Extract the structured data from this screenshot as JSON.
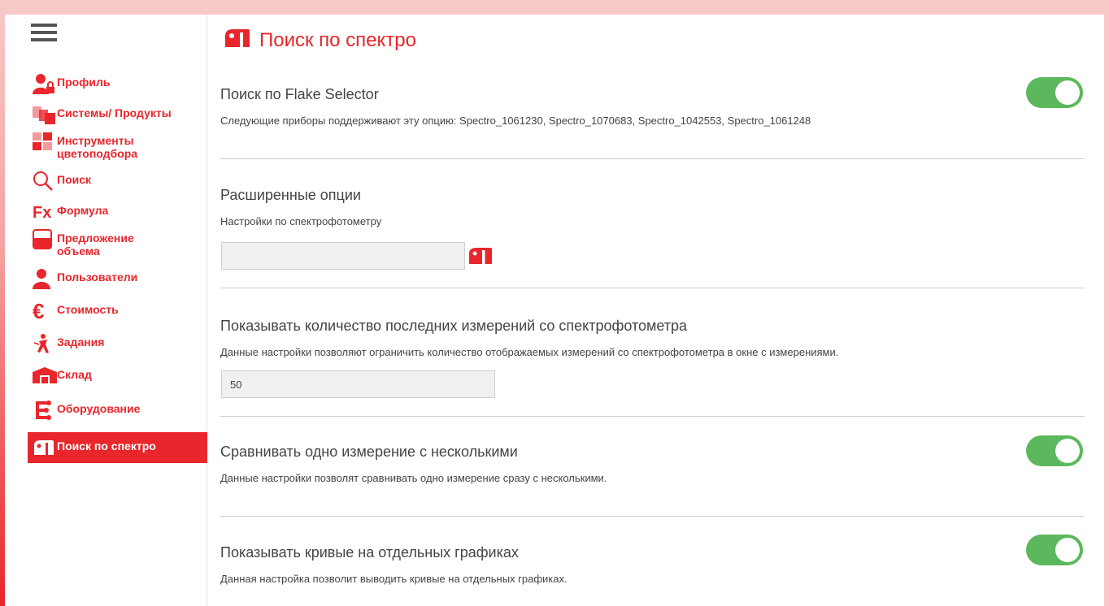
{
  "sidebar": {
    "items": [
      {
        "label": "Профиль",
        "icon": "user-lock-icon"
      },
      {
        "label": "Системы/ Продукты",
        "icon": "paint-cans-icon"
      },
      {
        "label": "Инструменты цветоподбора",
        "icon": "color-tools-grid-icon"
      },
      {
        "label": "Поиск",
        "icon": "search-icon"
      },
      {
        "label": "Формула",
        "icon": "formula-fx-icon"
      },
      {
        "label": "Предложение объема",
        "icon": "volume-can-icon"
      },
      {
        "label": "Пользователи",
        "icon": "user-icon"
      },
      {
        "label": "Стоимость",
        "icon": "euro-icon"
      },
      {
        "label": "Задания",
        "icon": "spray-task-icon"
      },
      {
        "label": "Склад",
        "icon": "warehouse-box-icon"
      },
      {
        "label": "Оборудование",
        "icon": "equipment-tree-icon"
      },
      {
        "label": "Поиск по спектро",
        "icon": "spectro-device-icon",
        "active": true
      }
    ]
  },
  "page": {
    "title": "Поиск по спектро",
    "title_icon": "spectro-device-icon"
  },
  "sections": {
    "flake": {
      "title": "Поиск по Flake Selector",
      "desc": "Следующие приборы поддерживают эту опцию: Spectro_1061230, Spectro_1070683, Spectro_1042553, Spectro_1061248",
      "enabled": true
    },
    "advanced": {
      "title": "Расширенные опции",
      "desc": "Настройки по спектрофотометру",
      "value": ""
    },
    "count": {
      "title": "Показывать количество последних измерений со спектрофотометра",
      "desc": "Данные настройки позволяют ограничить количество отображаемых измерений со спектрофотометра в окне с измерениями.",
      "value": "50"
    },
    "compare": {
      "title": "Сравнивать одно измерение с несколькими",
      "desc": "Данные настройки позволят сравнивать одно измерение сразу с несколькими.",
      "enabled": true
    },
    "curves": {
      "title": "Показывать кривые на отдельных графиках",
      "desc": "Данная настройка позволит выводить кривые на отдельных графиках.",
      "enabled": true
    }
  },
  "colors": {
    "accent": "#e8262b",
    "toggle_on": "#5cb85c"
  }
}
